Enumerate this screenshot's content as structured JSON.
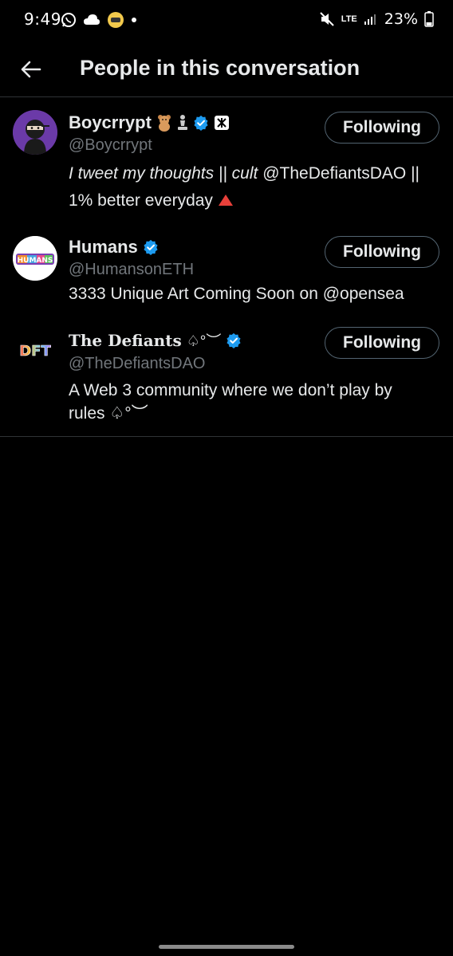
{
  "status_bar": {
    "time": "9:49",
    "network": "LTE",
    "battery": "23%"
  },
  "header": {
    "title": "People in this conversation"
  },
  "users": [
    {
      "name": "Boycrrypt",
      "handle": "@Boycrrypt",
      "bio_parts": [
        "I tweet my thoughts || cult",
        " @TheDefiantsDAO ||",
        "1% better everyday"
      ],
      "follow_label": "Following"
    },
    {
      "name": "Humans",
      "handle": "@HumansonETH",
      "bio": "3333 Unique Art Coming Soon on @opensea",
      "avatar_text": "HUMANS",
      "follow_label": "Following"
    },
    {
      "name": "The Defiants",
      "name_suffix": "♤°︶",
      "handle": "@TheDefiantsDAO",
      "bio_line1": "A Web 3 community where we don’t play by",
      "bio_line2": "rules",
      "bio_suffix": "♤°︶",
      "avatar_text": "DFT",
      "follow_label": "Following"
    }
  ],
  "colors": {
    "background": "#000000",
    "text": "#e7e9ea",
    "secondary_text": "#71767b",
    "verified_blue": "#1d9bf0",
    "divider": "#2f3336"
  }
}
